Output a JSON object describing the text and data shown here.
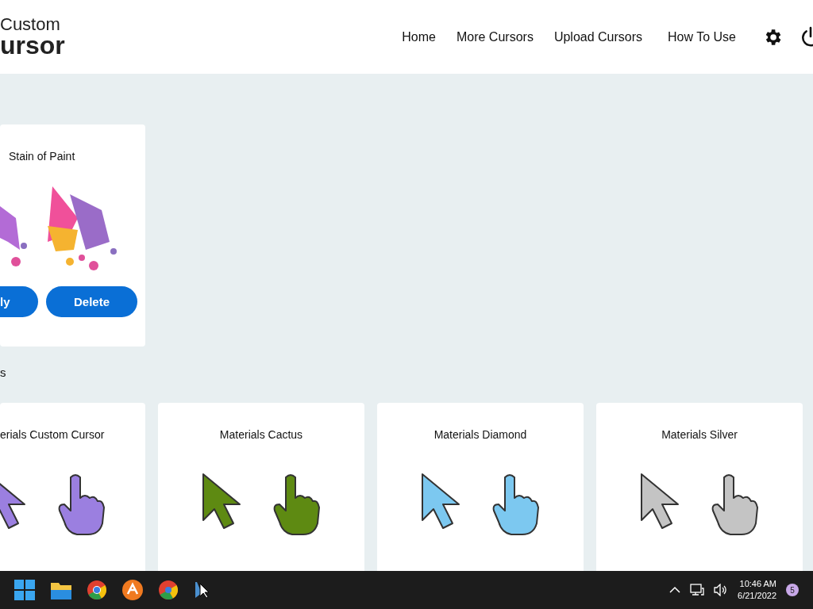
{
  "header": {
    "logo": [
      "Custom",
      "ursor"
    ],
    "nav": [
      {
        "label": "Home"
      },
      {
        "label": "More Cursors"
      },
      {
        "label": "Upload Cursors"
      },
      {
        "label": "How To Use"
      }
    ]
  },
  "applied": {
    "title": "Stain of Paint",
    "buttons": [
      "ly",
      "Delete"
    ]
  },
  "section_heading": "s",
  "cursor_packs": [
    {
      "title": "erials Custom Cursor",
      "color": "#9b7fe0"
    },
    {
      "title": "Materials Cactus",
      "color": "#5e8a12"
    },
    {
      "title": "Materials Diamond",
      "color": "#7cc8f0"
    },
    {
      "title": "Materials Silver",
      "color": "#c4c4c4"
    }
  ],
  "taskbar": {
    "time": "10:46 AM",
    "date": "6/21/2022",
    "notifications": "5"
  }
}
